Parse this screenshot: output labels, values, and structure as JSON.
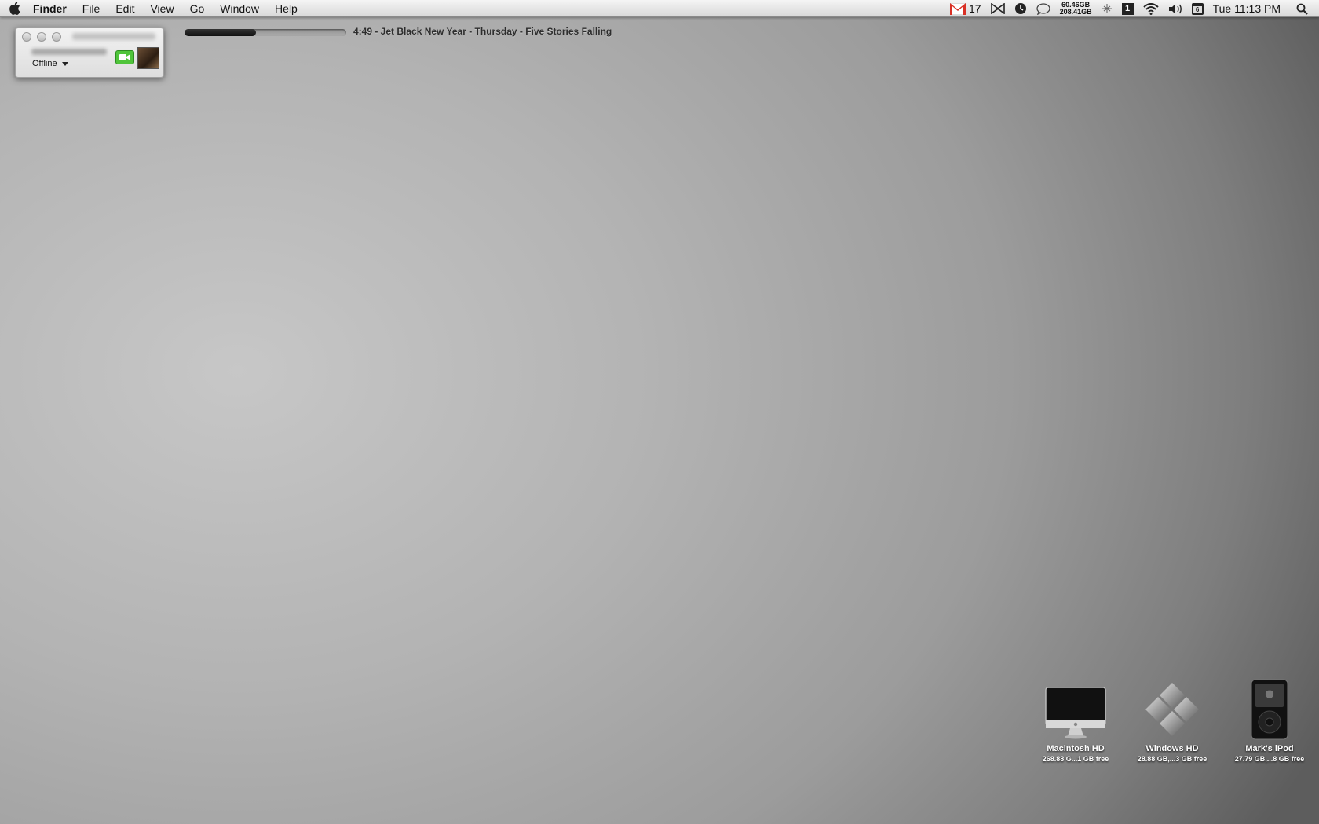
{
  "menubar": {
    "app_name": "Finder",
    "menus": [
      "File",
      "Edit",
      "View",
      "Go",
      "Window",
      "Help"
    ],
    "gmail_count": "17",
    "disk_used": "60.46GB",
    "disk_total": "208.41GB",
    "spaces_number": "1",
    "calendar_day": "6",
    "clock": "Tue 11:13 PM"
  },
  "chat": {
    "status": "Offline"
  },
  "now_playing": {
    "progress": 0.44,
    "text": "4:49 - Jet Black New Year - Thursday - Five Stories Falling"
  },
  "desktop_icons": [
    {
      "name": "Macintosh HD",
      "info": "268.88 G...1 GB free"
    },
    {
      "name": "Windows HD",
      "info": "28.88 GB,...3 GB free"
    },
    {
      "name": "Mark's iPod",
      "info": "27.79 GB,...8 GB free"
    }
  ],
  "colors": {
    "gmail_red": "#d93025",
    "facetime_green": "#4fc43a"
  }
}
